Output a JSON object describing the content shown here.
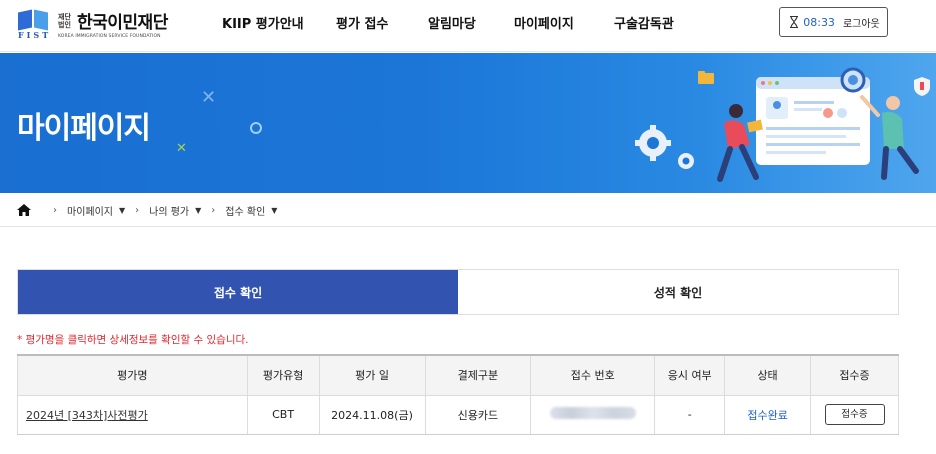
{
  "logo": {
    "small_label": "재단\n법인",
    "name": "한국이민재단",
    "subtitle": "KOREA IMMIGRATION SERVICE FOUNDATION",
    "mark_text": "FIST"
  },
  "nav": [
    {
      "label": "KIIP 평가안내"
    },
    {
      "label": "평가 접수"
    },
    {
      "label": "알림마당"
    },
    {
      "label": "마이페이지"
    },
    {
      "label": "구술감독관"
    }
  ],
  "session": {
    "timer": "08:33",
    "logout_label": "로그아웃"
  },
  "banner": {
    "title": "마이페이지"
  },
  "breadcrumb": {
    "items": [
      {
        "label": "마이페이지"
      },
      {
        "label": "나의 평가"
      },
      {
        "label": "접수 확인"
      }
    ]
  },
  "tabs": [
    {
      "label": "접수 확인",
      "active": true
    },
    {
      "label": "성적 확인",
      "active": false
    }
  ],
  "notice": "* 평가명을 클릭하면 상세정보를 확인할 수 있습니다.",
  "table": {
    "headers": [
      "평가명",
      "평가유형",
      "평가 일",
      "결제구분",
      "접수 번호",
      "응시 여부",
      "상태",
      "접수증"
    ],
    "rows": [
      {
        "name": "2024년 [343차]사전평가",
        "type": "CBT",
        "date": "2024.11.08(금)",
        "payment": "신용카드",
        "attendance": "-",
        "status": "접수완료",
        "receipt_button": "접수증"
      }
    ]
  },
  "colors": {
    "primary": "#3353b0",
    "banner": "#1b76d8",
    "notice": "#e0262d",
    "link": "#1e5fd1"
  }
}
